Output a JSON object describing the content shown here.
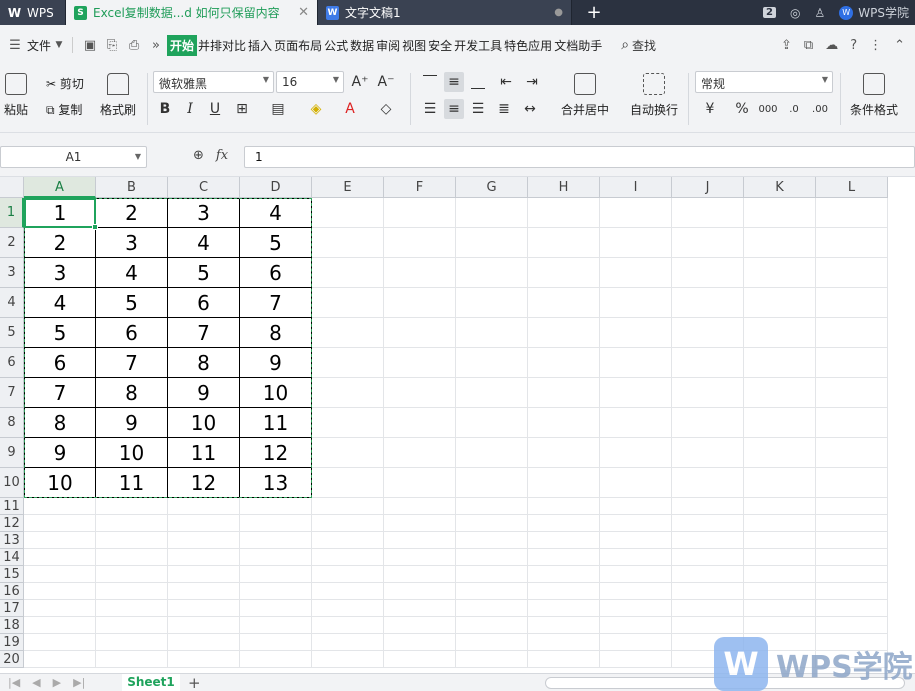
{
  "tabs": {
    "wps": "WPS",
    "active_file": "Excel复制数据...d 如何只保留内容",
    "doc_file": "文字文稿1",
    "close_glyph": "✕",
    "plus": "+",
    "count_badge": "2",
    "academy": "WPS学院"
  },
  "menu": {
    "file": "文件",
    "items": [
      "开始",
      "并排对比",
      "插入",
      "页面布局",
      "公式",
      "数据",
      "审阅",
      "视图",
      "安全",
      "开发工具",
      "特色应用",
      "文档助手"
    ],
    "active_index": 0,
    "search": "查找"
  },
  "ribbon": {
    "paste": "粘贴",
    "cut": "剪切",
    "copy": "复制",
    "format_painter": "格式刷",
    "font_name": "微软雅黑",
    "font_size": "16",
    "merge_center": "合并居中",
    "wrap_text": "自动换行",
    "number_format": "常规",
    "conditional_format": "条件格式"
  },
  "formula_bar": {
    "name_box": "A1",
    "fx": "fx",
    "value": "1"
  },
  "sheet": {
    "columns": [
      "A",
      "B",
      "C",
      "D",
      "E",
      "F",
      "G",
      "H",
      "I",
      "J",
      "K",
      "L"
    ],
    "rows": [
      "1",
      "2",
      "3",
      "4",
      "5",
      "6",
      "7",
      "8",
      "9",
      "10",
      "11",
      "12",
      "13",
      "14",
      "15",
      "16",
      "17",
      "18",
      "19",
      "20"
    ],
    "data": [
      [
        "1",
        "2",
        "3",
        "4"
      ],
      [
        "2",
        "3",
        "4",
        "5"
      ],
      [
        "3",
        "4",
        "5",
        "6"
      ],
      [
        "4",
        "5",
        "6",
        "7"
      ],
      [
        "5",
        "6",
        "7",
        "8"
      ],
      [
        "6",
        "7",
        "8",
        "9"
      ],
      [
        "7",
        "8",
        "9",
        "10"
      ],
      [
        "8",
        "9",
        "10",
        "11"
      ],
      [
        "9",
        "10",
        "11",
        "12"
      ],
      [
        "10",
        "11",
        "12",
        "13"
      ]
    ]
  },
  "sheet_tabs": {
    "active": "Sheet1",
    "add": "+"
  },
  "watermark": {
    "logo": "W",
    "text": "WPS学院"
  }
}
